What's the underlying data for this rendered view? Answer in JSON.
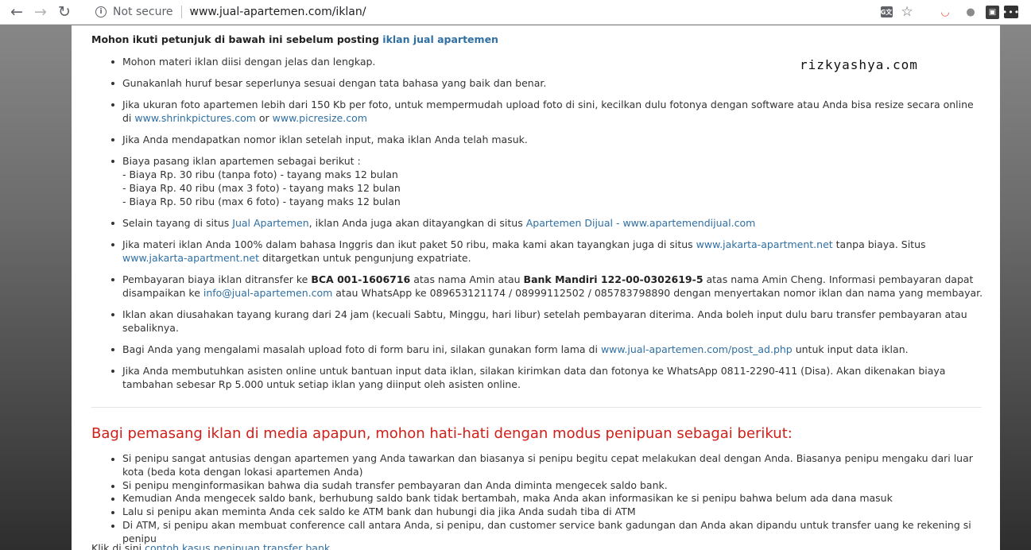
{
  "browser": {
    "back_icon": "arrow-left-icon",
    "forward_icon": "arrow-right-icon",
    "reload_icon": "reload-icon",
    "security_label": "Not secure",
    "url": "www.jual-apartemen.com/iklan/",
    "translate_glyph": "G文",
    "star_glyph": "☆"
  },
  "watermark": "rizkyashya.com",
  "intro": {
    "text": "Mohon ikuti petunjuk di bawah ini sebelum posting ",
    "link": "iklan jual apartemen"
  },
  "rules": {
    "r1": "Mohon materi iklan diisi dengan jelas dan lengkap.",
    "r2": "Gunakanlah huruf besar seperlunya sesuai dengan tata bahasa yang baik dan benar.",
    "r3_text": "Jika ukuran foto apartemen lebih dari 150 Kb per foto, untuk mempermudah upload foto di sini, kecilkan dulu fotonya dengan software atau Anda bisa resize secara online di ",
    "r3_link1": "www.shrinkpictures.com",
    "r3_or": " or ",
    "r3_link2": "www.picresize.com",
    "r4": "Jika Anda mendapatkan nomor iklan setelah input, maka iklan Anda telah masuk.",
    "r5_title": "Biaya pasang iklan apartemen sebagai berikut :",
    "r5_fee1": "- Biaya Rp. 30 ribu (tanpa foto) - tayang maks 12 bulan",
    "r5_fee2": "- Biaya Rp. 40 ribu (max 3 foto) - tayang maks 12 bulan",
    "r5_fee3": "- Biaya Rp. 50 ribu (max 6 foto) - tayang maks 12 bulan",
    "r6_text1": "Selain tayang di situs ",
    "r6_link1": "Jual Apartemen",
    "r6_text2": ", iklan Anda juga akan ditayangkan di situs ",
    "r6_link2": "Apartemen Dijual - www.apartemendijual.com",
    "r7_text1": "Jika materi iklan Anda 100% dalam bahasa Inggris dan ikut paket 50 ribu, maka kami akan tayangkan juga di situs ",
    "r7_link1": "www.jakarta-apartment.net",
    "r7_text2": " tanpa biaya. Situs ",
    "r7_link2": "www.jakarta-apartment.net",
    "r7_text3": " ditargetkan untuk pengunjung expatriate.",
    "r8_text1": "Pembayaran biaya iklan ditransfer ke ",
    "r8_bank1": "BCA 001-1606716",
    "r8_text2": " atas nama Amin atau ",
    "r8_bank2": "Bank Mandiri 122-00-0302619-5",
    "r8_text3": " atas nama Amin Cheng. Informasi pembayaran dapat disampaikan ke ",
    "r8_email": "info@jual-apartemen.com",
    "r8_text4": " atau WhatsApp ke 089653121174 / 08999112502 / 085783798890 dengan menyertakan nomor iklan dan nama yang membayar.",
    "r9": "Iklan akan diusahakan tayang kurang dari 24 jam (kecuali Sabtu, Minggu, hari libur) setelah pembayaran diterima. Anda boleh input dulu baru transfer pembayaran atau sebaliknya.",
    "r10_text1": "Bagi Anda yang mengalami masalah upload foto di form baru ini, silakan gunakan form lama di ",
    "r10_link": "www.jual-apartemen.com/post_ad.php",
    "r10_text2": " untuk input data iklan.",
    "r11": "Jika Anda membutuhkan asisten online untuk bantuan input data iklan, silakan kirimkan data dan fotonya ke WhatsApp 0811-2290-411 (Disa). Akan dikenakan biaya tambahan sebesar Rp 5.000 untuk setiap iklan yang diinput oleh asisten online."
  },
  "warning": {
    "title": "Bagi pemasang iklan di media apapun, mohon hati-hati dengan modus penipuan sebagai berikut:",
    "items": [
      "Si penipu sangat antusias dengan apartemen yang Anda tawarkan dan biasanya si penipu begitu cepat melakukan deal dengan Anda. Biasanya penipu mengaku dari luar kota (beda kota dengan lokasi apartemen Anda)",
      "Si penipu menginformasikan bahwa dia sudah transfer pembayaran dan Anda diminta mengecek saldo bank.",
      "Kemudian Anda mengecek saldo bank, berhubung saldo bank tidak bertambah, maka Anda akan informasikan ke si penipu bahwa belum ada dana masuk",
      "Lalu si penipu akan meminta Anda cek saldo ke ATM bank dan hubungi dia jika Anda sudah tiba di ATM",
      "Di ATM, si penipu akan membuat conference call antara Anda, si penipu, dan customer service bank gadungan dan Anda akan dipandu untuk transfer uang ke rekening si penipu"
    ]
  },
  "footer": {
    "text": "Klik di sini ",
    "link": "contoh kasus penipuan transfer bank"
  }
}
